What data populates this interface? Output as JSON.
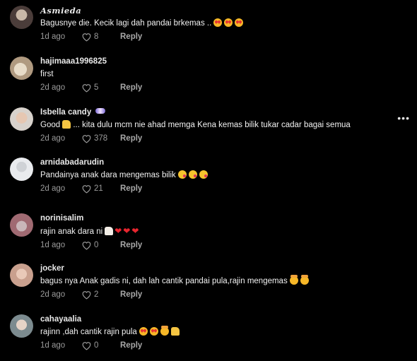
{
  "colors": {
    "background": "#000000",
    "text_primary": "#f2f2f2",
    "text_secondary": "#9a9a9a"
  },
  "comments": [
    {
      "username": "Asmieda",
      "text": "Bagusnye die. Kecik lagi dah pandai brkemas ..",
      "emojis": [
        "love",
        "love",
        "love"
      ],
      "age": "1d ago",
      "likes": "8",
      "reply_label": "Reply"
    },
    {
      "username": "hajimaaa1996825",
      "text": "first",
      "emojis": [],
      "age": "2d ago",
      "likes": "5",
      "reply_label": "Reply"
    },
    {
      "username": "Isbella candy",
      "text": "Good",
      "text_rest": "... kita dulu mcm nie ahad memga Kena kemas bilik tukar cadar bagai semua",
      "emojis": [
        "thumbs-up"
      ],
      "age": "2d ago",
      "likes": "378",
      "reply_label": "Reply"
    },
    {
      "username": "arnidabadarudin",
      "text": "Pandainya anak dara mengemas bilik",
      "emojis": [
        "kiss",
        "kiss",
        "kiss"
      ],
      "age": "2d ago",
      "likes": "21",
      "reply_label": "Reply"
    },
    {
      "username": "norinisalim",
      "text": "rajin anak dara ni",
      "emojis": [
        "thumbs-up",
        "heart",
        "heart",
        "heart"
      ],
      "age": "1d ago",
      "likes": "0",
      "reply_label": "Reply"
    },
    {
      "username": "jocker",
      "text": "bagus nya Anak gadis ni, dah lah cantik pandai pula,rajin mengemas",
      "emojis": [
        "blush",
        "blush"
      ],
      "age": "2d ago",
      "likes": "2",
      "reply_label": "Reply"
    },
    {
      "username": "cahayaalia",
      "text": "rajinn ,dah cantik rajin pula",
      "emojis": [
        "love",
        "love",
        "blush",
        "thumbs-up"
      ],
      "age": "1d ago",
      "likes": "0",
      "reply_label": "Reply"
    }
  ],
  "more_menu": "•••"
}
